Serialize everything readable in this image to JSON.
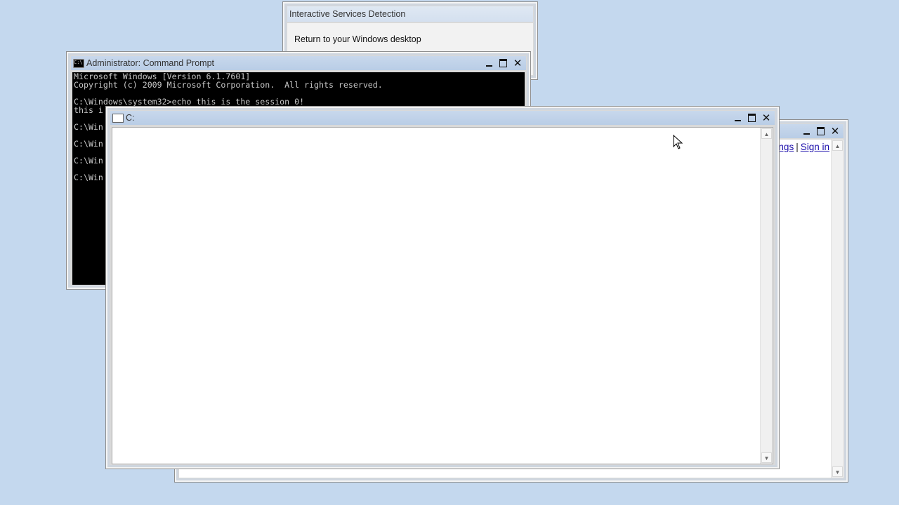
{
  "desktop": {
    "background": "#c4d8ee"
  },
  "isd_window": {
    "title": "Interactive Services Detection",
    "return_link": "Return to your Windows desktop"
  },
  "cmd_window": {
    "title": "Administrator:  Command Prompt",
    "lines": [
      "Microsoft Windows [Version 6.1.7601]",
      "Copyright (c) 2009 Microsoft Corporation.  All rights reserved.",
      "",
      "C:\\Windows\\system32>echo this is the session 0!",
      "this i",
      "",
      "C:\\Win",
      "",
      "C:\\Win",
      "",
      "C:\\Win",
      "",
      "C:\\Win"
    ]
  },
  "browser_window": {
    "link_settings": "ngs",
    "link_separator": "|",
    "link_signin": "Sign in"
  },
  "c_window": {
    "title": "C:"
  },
  "icons": {
    "minimize": "minimize-icon",
    "maximize": "maximize-icon",
    "close": "close-icon",
    "scroll_up": "scroll-up-arrow-icon",
    "scroll_down": "scroll-down-arrow-icon",
    "cursor": "mouse-pointer-icon"
  },
  "glyphs": {
    "close": "✕",
    "up": "▲",
    "down": "▼"
  }
}
